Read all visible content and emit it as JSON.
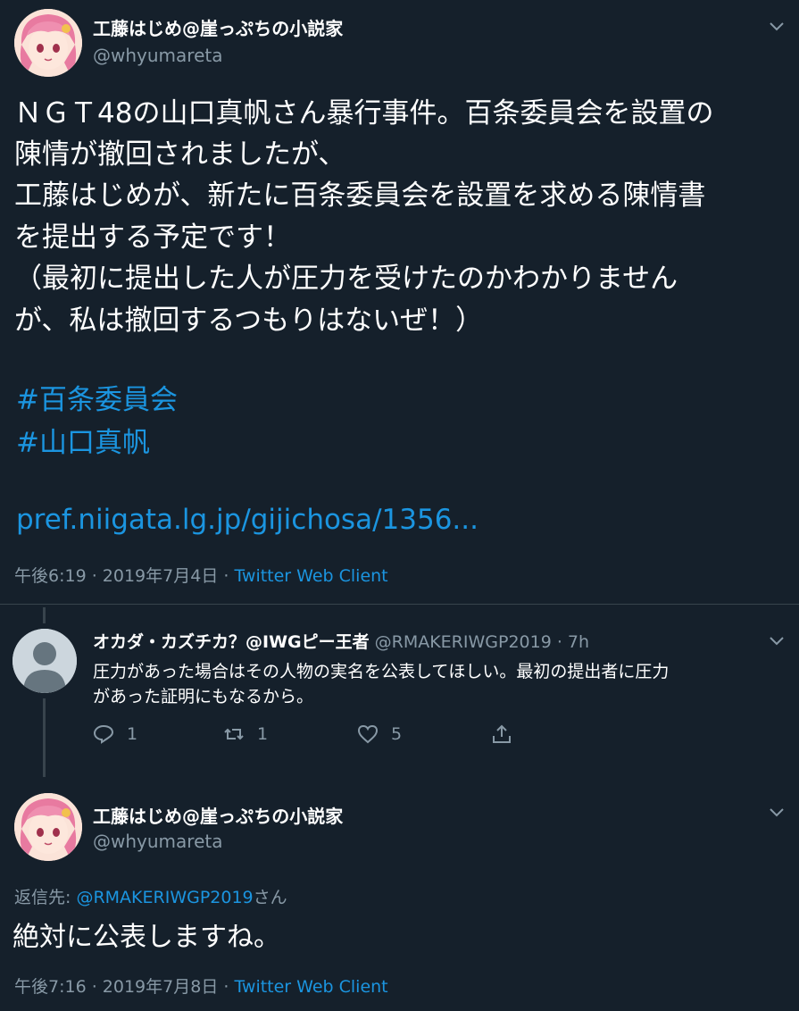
{
  "tweet1": {
    "display_name": "工藤はじめ@崖っぷちの小説家",
    "handle": "@whyumareta",
    "lines": [
      "ＮＧＴ48の山口真帆さん暴行事件。百条委員会を設置の",
      "陳情が撤回されましたが、",
      "工藤はじめが、新たに百条委員会を設置を求める陳情書",
      "を提出する予定です！",
      "（最初に提出した人が圧力を受けたのかわかりません",
      "が、私は撤回するつもりはないぜ！）"
    ],
    "hashtags": [
      "#百条委員会",
      "#山口真帆"
    ],
    "link": "pref.niigata.lg.jp/gijichosa/1356...",
    "timestamp": "午後6:19 · 2019年7月4日 · ",
    "client": "Twitter Web Client"
  },
  "reply": {
    "display_name": "オカダ・カズチカ？@IWGピー王者",
    "handle": "@RMAKERIWGP2019 · 7h",
    "lines": [
      "圧力があった場合はその人物の実名を公表してほしい。最初の提出者に圧力",
      "があった証明にもなるから。"
    ],
    "actions": {
      "reply_count": "1",
      "retweet_count": "1",
      "like_count": "5"
    }
  },
  "tweet2": {
    "display_name": "工藤はじめ@崖っぷちの小説家",
    "handle": "@whyumareta",
    "replying_prefix": "返信先: ",
    "replying_mention": "@RMAKERIWGP2019",
    "replying_suffix": "さん",
    "body": "絶対に公表しますね。",
    "timestamp": "午後7:16 · 2019年7月8日 · ",
    "client": "Twitter Web Client"
  },
  "colors": {
    "background": "#15202b",
    "text": "#ffffff",
    "secondary": "#8899a6",
    "accent": "#1b95e0",
    "divider": "#38444d"
  },
  "icons": [
    "chevron-down-icon",
    "reply-icon",
    "retweet-icon",
    "like-icon",
    "share-icon",
    "default-avatar-icon"
  ]
}
